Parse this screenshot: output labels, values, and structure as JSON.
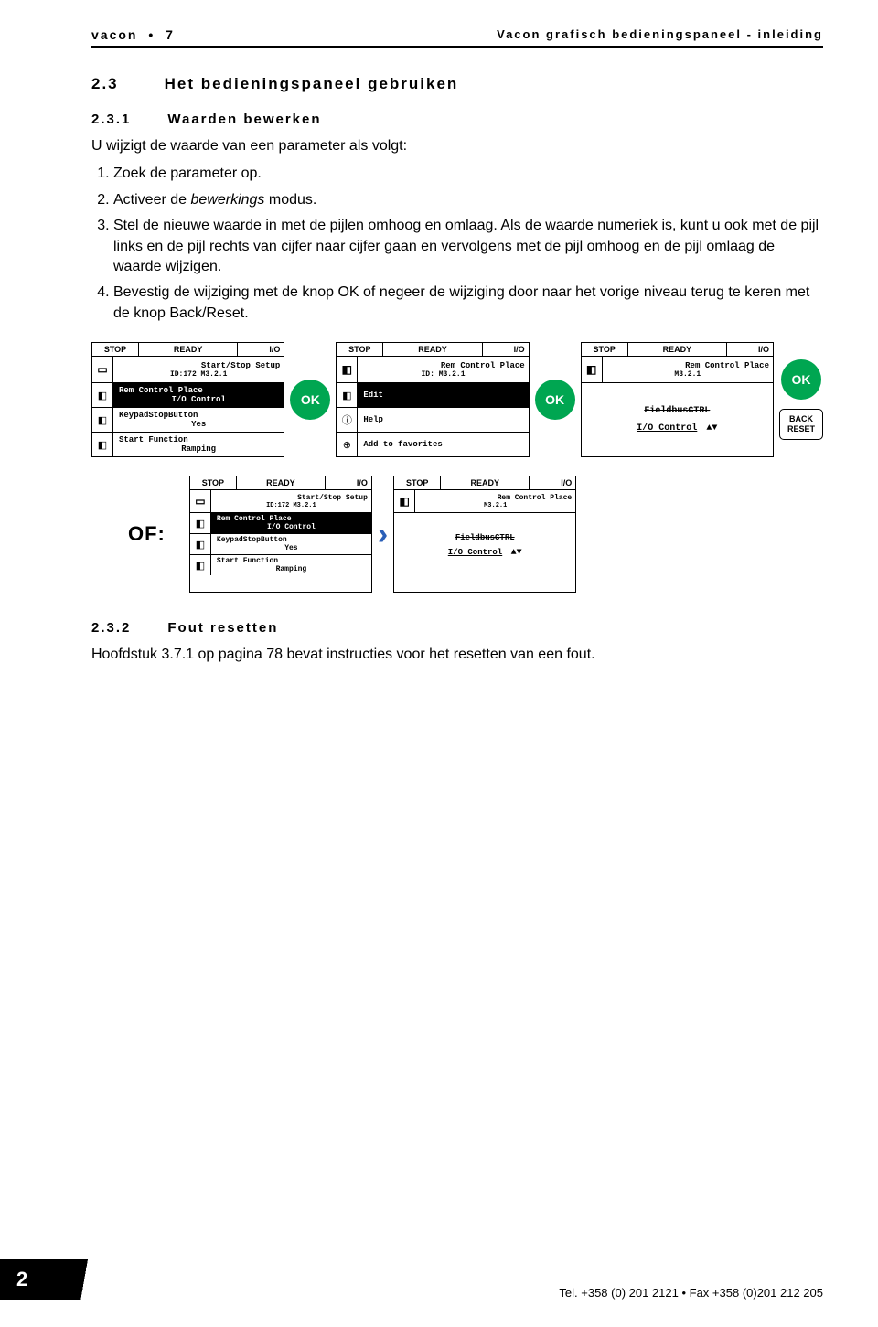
{
  "header": {
    "left_brand": "vacon",
    "left_page": "7",
    "right": "Vacon grafisch bedieningspaneel - inleiding"
  },
  "sec23": {
    "num": "2.3",
    "title": "Het bedieningspaneel gebruiken"
  },
  "sec231": {
    "num": "2.3.1",
    "title": "Waarden bewerken",
    "intro": "U wijzigt de waarde van een parameter als volgt:",
    "steps": [
      "Zoek de parameter op.",
      "Activeer de <em class='i'>bewerkings</em> modus.",
      "Stel de nieuwe waarde in met de pijlen omhoog en omlaag. Als de waarde numeriek is, kunt u ook met de pijl links en de pijl rechts van cijfer naar cijfer gaan en vervolgens met de pijl omhoog en de pijl omlaag de waarde wijzigen.",
      "Bevestig de wijziging met de knop OK of negeer de wijziging door naar het vorige niveau terug te keren met de knop Back/Reset."
    ]
  },
  "labels": {
    "stop": "STOP",
    "ready": "READY",
    "io": "I/O",
    "ok": "OK",
    "back1": "BACK",
    "back2": "RESET",
    "of": "OF:"
  },
  "panel1": {
    "title": "Start/Stop Setup",
    "sub": "ID:172    M3.2.1",
    "r1a": "Rem Control Place",
    "r1b": "I/O Control",
    "r2a": "KeypadStopButton",
    "r2b": "Yes",
    "r3a": "Start Function",
    "r3b": "Ramping"
  },
  "panel2": {
    "title": "Rem Control Place",
    "sub": "ID:        M3.2.1",
    "r1": "Edit",
    "r2": "Help",
    "r3": "Add to favorites"
  },
  "panel3": {
    "title": "Rem Control Place",
    "sub": "M3.2.1",
    "line1": "FieldbusCTRL",
    "line2": "I/O Control"
  },
  "sec232": {
    "num": "2.3.2",
    "title": "Fout resetten",
    "text": "Hoofdstuk 3.7.1 op pagina 78 bevat instructies voor het resetten van een fout."
  },
  "footer": {
    "contact": "Tel. +358 (0) 201 2121 • Fax +358 (0)201 212 205",
    "pagenum": "2"
  }
}
